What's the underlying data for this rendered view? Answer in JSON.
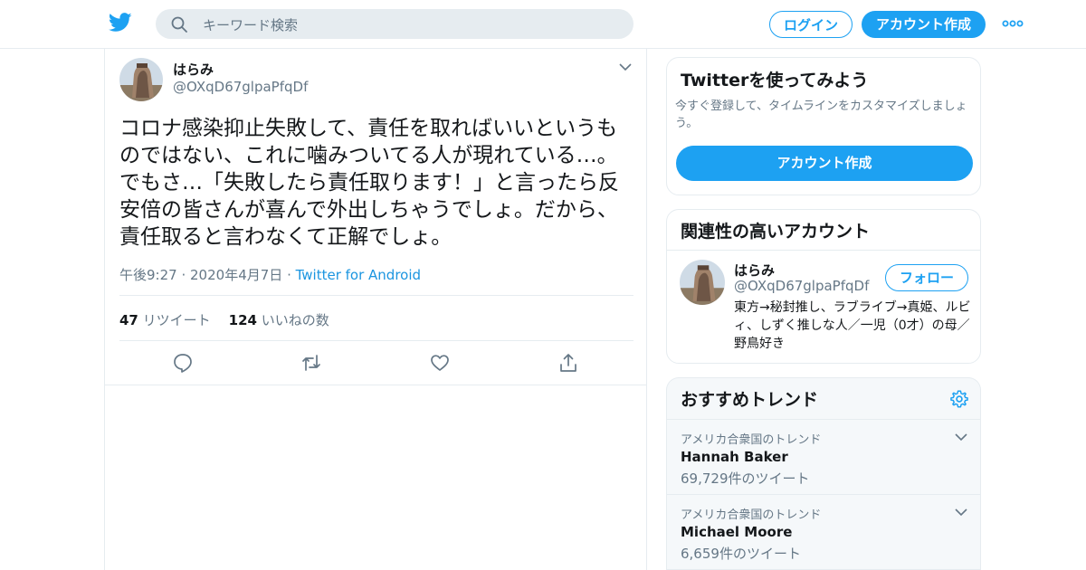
{
  "header": {
    "search_placeholder": "キーワード検索",
    "login_label": "ログイン",
    "signup_label": "アカウント作成",
    "brand_color": "#1da1f2"
  },
  "tweet": {
    "display_name": "はらみ",
    "handle": "@OXqD67glpaPfqDf",
    "text": "コロナ感染抑止失敗して、責任を取ればいいというものではない、これに噛みついてる人が現れている…。でもさ…「失敗したら責任取ります！」と言ったら反安倍の皆さんが喜んで外出しちゃうでしょ。だから、責任取ると言わなくて正解でしょ。",
    "time": "午後9:27",
    "date": "2020年4月7日",
    "source": "Twitter for Android",
    "retweet_count": "47",
    "retweet_label": "リツイート",
    "like_count": "124",
    "like_label": "いいねの数",
    "actions": [
      "reply-icon",
      "retweet-icon",
      "like-icon",
      "share-icon"
    ]
  },
  "signup_card": {
    "title": "Twitterを使ってみよう",
    "description": "今すぐ登録して、タイムラインをカスタマイズしましょう。",
    "button_label": "アカウント作成"
  },
  "related": {
    "title": "関連性の高いアカウント",
    "account": {
      "display_name": "はらみ",
      "handle": "@OXqD67glpaPfqDf",
      "follow_label": "フォロー",
      "bio": "東方→秘封推し、ラブライブ→真姫、ルビィ、しずく推しな人／一児（0才）の母／野鳥好き"
    }
  },
  "trends": {
    "title": "おすすめトレンド",
    "items": [
      {
        "context": "アメリカ合衆国のトレンド",
        "name": "Hannah Baker",
        "count": "69,729件のツイート"
      },
      {
        "context": "アメリカ合衆国のトレンド",
        "name": "Michael Moore",
        "count": "6,659件のツイート"
      }
    ]
  }
}
